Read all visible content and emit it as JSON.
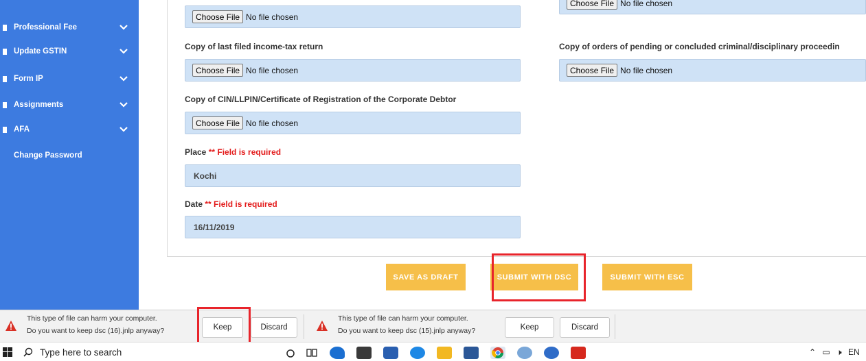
{
  "sidebar": {
    "items": [
      {
        "label": "Professional Fee",
        "has_chevron": true
      },
      {
        "label": "Update GSTIN",
        "has_chevron": true
      },
      {
        "label": "Form IP",
        "has_chevron": true
      },
      {
        "label": "Assignments",
        "has_chevron": true
      },
      {
        "label": "AFA",
        "has_chevron": true
      },
      {
        "label": "Change Password",
        "has_chevron": false
      }
    ]
  },
  "form": {
    "file_button_label": "Choose File",
    "no_file_text": "No file chosen",
    "labels": {
      "income_tax": "Copy of last filed income-tax return",
      "orders": "Copy of orders of pending or concluded criminal/disciplinary proceedin",
      "cin": "Copy of CIN/LLPIN/Certificate of Registration of the Corporate Debtor",
      "place": "Place",
      "date": "Date"
    },
    "required_text": "** Field is required",
    "place_value": "Kochi",
    "date_value": "16/11/2019"
  },
  "actions": {
    "save_draft": "SAVE AS DRAFT",
    "submit_dsc": "SUBMIT WITH DSC",
    "submit_esc": "SUBMIT WITH ESC"
  },
  "downloads": [
    {
      "line1": "This type of file can harm your computer.",
      "line2": "Do you want to keep dsc (16).jnlp anyway?",
      "keep": "Keep",
      "discard": "Discard"
    },
    {
      "line1": "This type of file can harm your computer.",
      "line2": "Do you want to keep dsc (15).jnlp anyway?",
      "keep": "Keep",
      "discard": "Discard"
    }
  ],
  "taskbar": {
    "search_placeholder": "Type here to search",
    "tray_text": "EN"
  },
  "colors": {
    "sidebar": "#3d7be0",
    "accent_button": "#f6bf49",
    "required": "#e31b1b",
    "highlight": "#e8242b",
    "field_bg": "#cfe2f6"
  }
}
